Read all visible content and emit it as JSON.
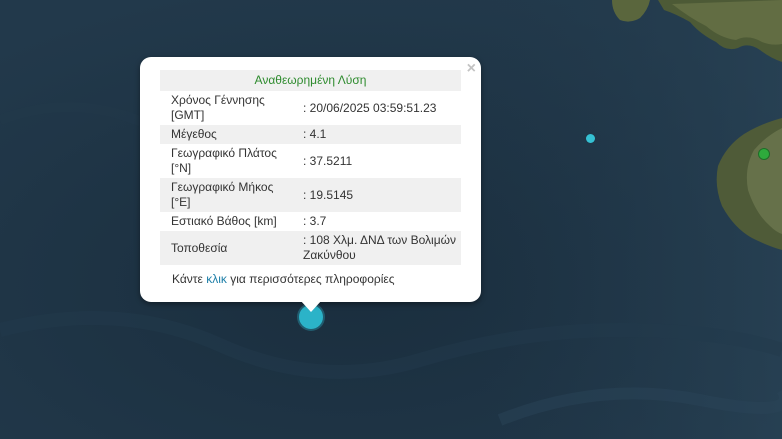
{
  "popup": {
    "header": "Αναθεωρημένη Λύση",
    "close_icon": "×",
    "rows": [
      {
        "label": "Χρόνος Γέννησης [GMT]",
        "value": ": 20/06/2025 03:59:51.23"
      },
      {
        "label": "Μέγεθος",
        "value": ": 4.1"
      },
      {
        "label": "Γεωγραφικό Πλάτος [°N]",
        "value": ": 37.5211"
      },
      {
        "label": "Γεωγραφικό Μήκος [°E]",
        "value": ": 19.5145"
      },
      {
        "label": "Εστιακό Βάθος [km]",
        "value": ": 3.7"
      },
      {
        "label": "Τοποθεσία",
        "value": ": 108 Χλμ. ΔΝΔ των Βολιμών Ζακύνθου"
      }
    ],
    "more_prefix": "Κάντε ",
    "more_link": "κλικ",
    "more_suffix": " για περισσότερες πληροφορίες"
  },
  "colors": {
    "sea": "#1c3141",
    "land": "#5f6b3f",
    "marker": "#2bb3c8",
    "marker_green": "#2eaa3c",
    "header_text": "#2e8b2e",
    "link": "#1e7fa8"
  }
}
